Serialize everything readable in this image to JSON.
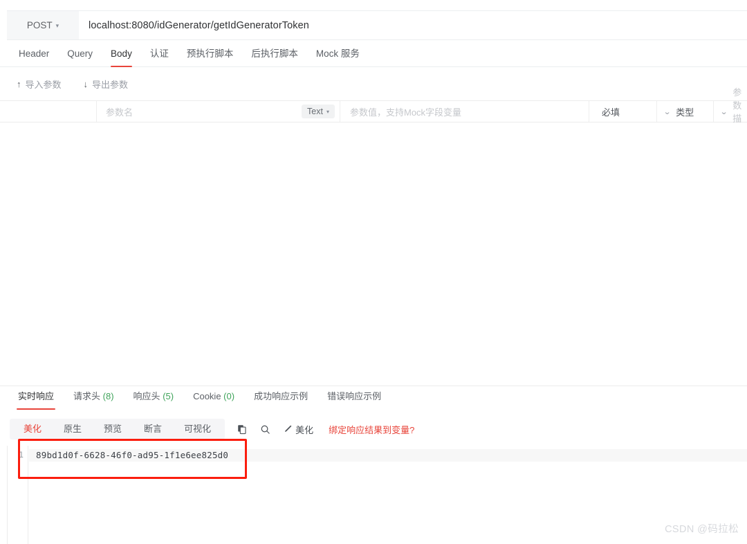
{
  "request": {
    "method": "POST",
    "method_caret": "▾",
    "url": "localhost:8080/idGenerator/getIdGeneratorToken"
  },
  "main_tabs": [
    {
      "label": "Header",
      "active": false
    },
    {
      "label": "Query",
      "active": false
    },
    {
      "label": "Body",
      "active": true
    },
    {
      "label": "认证",
      "active": false
    },
    {
      "label": "预执行脚本",
      "active": false
    },
    {
      "label": "后执行脚本",
      "active": false
    },
    {
      "label": "Mock 服务",
      "active": false
    }
  ],
  "param_toolbar": {
    "import_label": "导入参数",
    "import_glyph": "↑",
    "export_label": "导出参数",
    "export_glyph": "↓"
  },
  "param_header": {
    "name_placeholder": "参数名",
    "type_pill": "Text",
    "type_pill_caret": "▾",
    "value_placeholder": "参数值，支持Mock字段变量",
    "required_label": "必填",
    "type_label": "类型",
    "desc_placeholder": "参数描述",
    "chevron": "⌄"
  },
  "response_tabs": [
    {
      "label": "实时响应",
      "count": "",
      "active": true
    },
    {
      "label": "请求头",
      "count": "(8)",
      "active": false
    },
    {
      "label": "响应头",
      "count": "(5)",
      "active": false
    },
    {
      "label": "Cookie",
      "count": "(0)",
      "active": false
    },
    {
      "label": "成功响应示例",
      "count": "",
      "active": false
    },
    {
      "label": "错误响应示例",
      "count": "",
      "active": false
    }
  ],
  "response_bar": {
    "view_tabs": [
      {
        "label": "美化",
        "active": true
      },
      {
        "label": "原生",
        "active": false
      },
      {
        "label": "预览",
        "active": false
      },
      {
        "label": "断言",
        "active": false
      },
      {
        "label": "可视化",
        "active": false
      }
    ],
    "copy_icon": "copy-icon",
    "search_icon": "search-icon",
    "format_label": "美化",
    "format_icon": "wand-icon",
    "bind_link": "绑定响应结果到变量?"
  },
  "editor": {
    "lines": [
      {
        "number": "1",
        "text": "89bd1d0f-6628-46f0-ad95-1f1e6ee825d0"
      }
    ]
  },
  "watermark": "CSDN @码拉松",
  "colors": {
    "accent_red": "#e8443a",
    "annotation_red": "#fb1d0e",
    "count_green": "#3fa35a",
    "panel_gray": "#f5f5f7"
  }
}
